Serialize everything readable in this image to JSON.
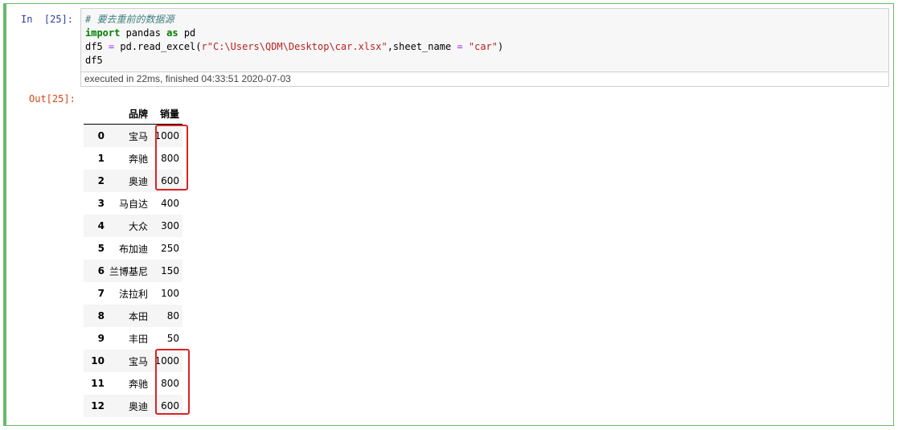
{
  "cell": {
    "in_prompt": "In  [25]:",
    "out_prompt": "Out[25]:",
    "code": {
      "comment": "# 要去重前的数据源",
      "line2_kw1": "import",
      "line2_mod": " pandas ",
      "line2_kw2": "as",
      "line2_alias": " pd",
      "line3_a": "df5 ",
      "line3_eq": "=",
      "line3_b": " pd.read_excel(",
      "line3_str1": "r\"C:\\Users\\QDM\\Desktop\\car.xlsx\"",
      "line3_c": ",sheet_name ",
      "line3_eq2": "=",
      "line3_d": " ",
      "line3_str2": "\"car\"",
      "line3_e": ")",
      "line4": "df5"
    },
    "exec_info": "executed in 22ms, finished 04:33:51 2020-07-03"
  },
  "table": {
    "columns": [
      "品牌",
      "销量"
    ],
    "rows": [
      {
        "index": "0",
        "brand": "宝马",
        "sales": "1000"
      },
      {
        "index": "1",
        "brand": "奔驰",
        "sales": "800"
      },
      {
        "index": "2",
        "brand": "奥迪",
        "sales": "600"
      },
      {
        "index": "3",
        "brand": "马自达",
        "sales": "400"
      },
      {
        "index": "4",
        "brand": "大众",
        "sales": "300"
      },
      {
        "index": "5",
        "brand": "布加迪",
        "sales": "250"
      },
      {
        "index": "6",
        "brand": "兰博基尼",
        "sales": "150"
      },
      {
        "index": "7",
        "brand": "法拉利",
        "sales": "100"
      },
      {
        "index": "8",
        "brand": "本田",
        "sales": "80"
      },
      {
        "index": "9",
        "brand": "丰田",
        "sales": "50"
      },
      {
        "index": "10",
        "brand": "宝马",
        "sales": "1000"
      },
      {
        "index": "11",
        "brand": "奔驰",
        "sales": "800"
      },
      {
        "index": "12",
        "brand": "奥迪",
        "sales": "600"
      }
    ]
  },
  "colors": {
    "cell_border": "#66bb6a",
    "highlight": "#dd2222",
    "in_prompt": "#303f9f",
    "out_prompt": "#d84315"
  }
}
